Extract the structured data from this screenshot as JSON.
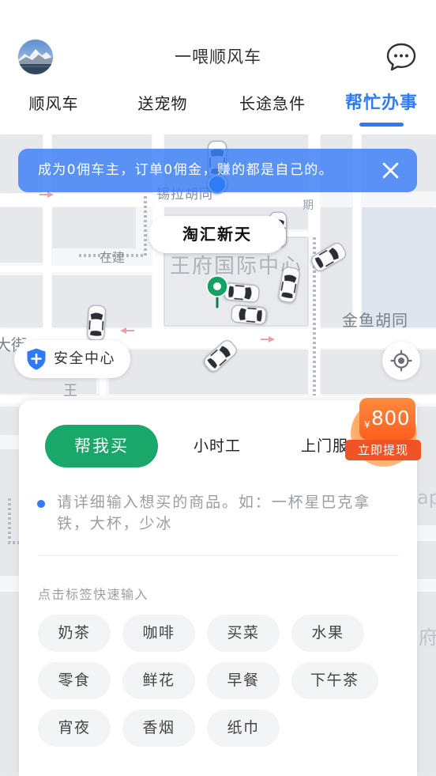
{
  "header": {
    "title": "一喂顺风车",
    "avatar": "avatar-landscape-photo",
    "message_icon": "chat-bubble-icon"
  },
  "tabs": [
    {
      "label": "顺风车",
      "active": false
    },
    {
      "label": "送宠物",
      "active": false
    },
    {
      "label": "长途急件",
      "active": false
    },
    {
      "label": "帮忙办事",
      "active": true
    }
  ],
  "banner": {
    "text": "成为0佣车主，订单0佣金，赚的都是自己的。",
    "close_icon": "close-icon"
  },
  "map": {
    "callout": "淘汇新天",
    "labels": {
      "xila_hutong": "锡拉胡同",
      "zaijian": "在建",
      "wangfu_center": "王府国际中心",
      "jinyu_hutong": "金鱼胡同",
      "dajie": "大街",
      "wang": "王",
      "qi": "期",
      "edge_ap": "ap",
      "edge_fu": "府"
    },
    "my_location_icon": "blue-dot-icon",
    "pickup_marker_icon": "green-pin-icon",
    "car_icon": "car-icon"
  },
  "safety_center": {
    "label": "安全中心",
    "icon": "shield-plus-icon"
  },
  "locate_button": {
    "icon": "crosshair-icon"
  },
  "service_tabs": [
    {
      "label": "帮我买",
      "active": true
    },
    {
      "label": "小时工",
      "active": false
    },
    {
      "label": "上门服",
      "active": false
    }
  ],
  "reward": {
    "currency": "¥",
    "amount": "800",
    "action": "立即提现"
  },
  "order_input": {
    "placeholder": "请详细输入想买的商品。如：一杯星巴克拿铁，大杯，少冰"
  },
  "quick_tags": {
    "title": "点击标签快速输入",
    "tags": [
      "奶茶",
      "咖啡",
      "买菜",
      "水果",
      "零食",
      "鲜花",
      "早餐",
      "下午茶",
      "宵夜",
      "香烟",
      "纸巾"
    ]
  },
  "colors": {
    "accent_blue": "#2f7bf5",
    "action_green": "#1aa76a",
    "reward_orange": "#ff6a20",
    "reward_red": "#f05426"
  }
}
